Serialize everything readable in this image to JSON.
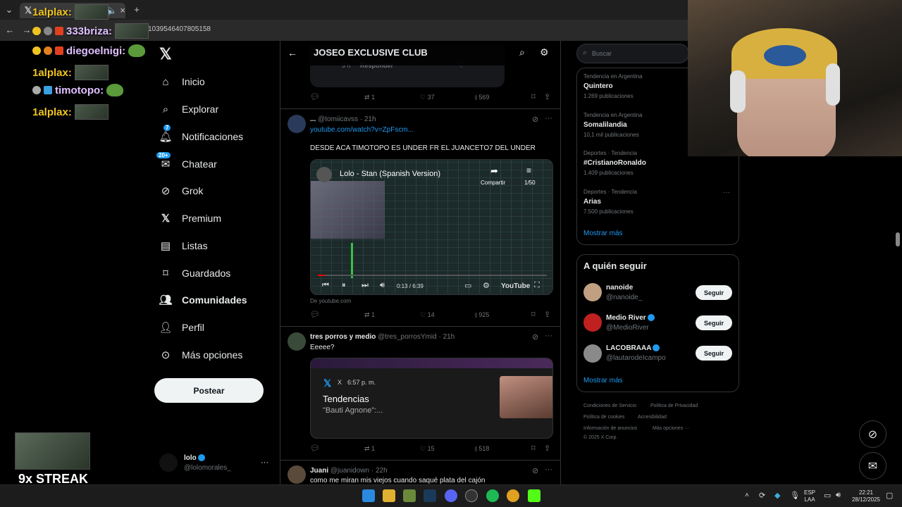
{
  "browser": {
    "url": "1039546407805158",
    "tab_close": "×",
    "new_tab": "+"
  },
  "chat": [
    {
      "user": "1alplax:"
    },
    {
      "user": "333briza:"
    },
    {
      "user": "diegoelnigi:"
    },
    {
      "user": "1alplax:"
    },
    {
      "user": "timotopo:"
    },
    {
      "user": "1alplax:"
    }
  ],
  "streak": "9x STREAK",
  "nav": {
    "items": [
      {
        "label": "Inicio"
      },
      {
        "label": "Explorar"
      },
      {
        "label": "Notificaciones",
        "badge": "7"
      },
      {
        "label": "Chatear",
        "badge": "20+"
      },
      {
        "label": "Grok"
      },
      {
        "label": "Premium"
      },
      {
        "label": "Listas"
      },
      {
        "label": "Guardados"
      },
      {
        "label": "Comunidades"
      },
      {
        "label": "Perfil"
      },
      {
        "label": "Más opciones"
      }
    ],
    "post_label": "Postear",
    "account_name": "lolo",
    "account_handle": "@lolomorales_",
    "account_more": "···"
  },
  "feed": {
    "title": "JOSEO EXCLUSIVE CLUB",
    "prev_reply_time": "3 h",
    "prev_reply_label": "Responder",
    "prev_actions": {
      "retweets": "1",
      "likes": "37",
      "views": "569"
    },
    "tweets": [
      {
        "name": "...",
        "handle": "@tomiicavss",
        "time": "21h",
        "link": "youtube.com/watch?v=ZpFscm...",
        "text": "DESDE ACA TIMOTOPO ES UNDER FR EL JUANCETO7 DEL UNDER",
        "video_title": "Lolo - Stan (Spanish Version)",
        "video_share": "Compartir",
        "video_playlist": "1/50",
        "video_time": "0:13 / 6:39",
        "video_brand": "YouTube",
        "source": "De youtube.com",
        "actions": {
          "retweets": "1",
          "likes": "14",
          "views": "925"
        }
      },
      {
        "name": "tres porros y medio",
        "handle": "@tres_porrosYmid",
        "time": "21h",
        "text": "Eeeee?",
        "embed_app": "X",
        "embed_time": "6:57 p. m.",
        "embed_title": "Tendencias",
        "embed_sub": "\"Bauti Agnone\":...",
        "actions": {
          "retweets": "1",
          "likes": "15",
          "views": "518"
        }
      },
      {
        "name": "Juani",
        "handle": "@juanidown",
        "time": "22h",
        "text": "como me miran mis viejos cuando saqué plata del cajón"
      }
    ]
  },
  "sidebar": {
    "search_placeholder": "Buscar",
    "trends": [
      {
        "category": "Tendencia en Argentina",
        "name": "Quintero",
        "count": "1.269 publicaciones"
      },
      {
        "category": "Tendencia en Argentina",
        "name": "Somalilandia",
        "count": "10,1 mil publicaciones"
      },
      {
        "category": "Deportes · Tendencia",
        "name": "#CristianoRonaldo",
        "count": "1.409 publicaciones"
      },
      {
        "category": "Deportes · Tendencia",
        "name": "Arias",
        "count": "7.500 publicaciones"
      }
    ],
    "trends_more_dots": "···",
    "show_more": "Mostrar más",
    "follow_title": "A quién seguir",
    "follow": [
      {
        "name": "nanoide",
        "handle": "@nanoide_",
        "verified": false
      },
      {
        "name": "Medio River",
        "handle": "@MedioRiver",
        "verified": true
      },
      {
        "name": "LACOBRAAA",
        "handle": "@lautarodeIcampo",
        "verified": true
      }
    ],
    "follow_btn": "Seguir",
    "follow_more": "Mostrar más",
    "footer": [
      "Condiciones de Servicio",
      "Política de Privacidad",
      "Política de cookies",
      "Accesibilidad",
      "Información de anuncios",
      "Más opciones ···",
      "© 2025 X Corp."
    ]
  },
  "taskbar": {
    "lang_top": "ESP",
    "lang_bottom": "LAA",
    "time": "22:21",
    "date": "28/12/2025"
  }
}
